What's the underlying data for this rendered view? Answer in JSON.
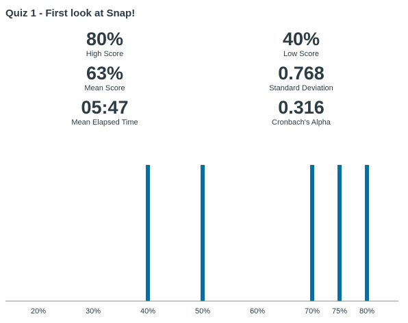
{
  "quiz": {
    "title": "Quiz 1 - First look at Snap!"
  },
  "stats": {
    "high_score": {
      "value": "80%",
      "label": "High Score"
    },
    "low_score": {
      "value": "40%",
      "label": "Low Score"
    },
    "mean_score": {
      "value": "63%",
      "label": "Mean Score"
    },
    "standard_deviation": {
      "value": "0.768",
      "label": "Standard Deviation"
    },
    "mean_elapsed_time": {
      "value": "05:47",
      "label": "Mean Elapsed Time"
    },
    "cronbachs_alpha": {
      "value": "0.316",
      "label": "Cronbach's Alpha"
    }
  },
  "colors": {
    "bar": "#0770a3",
    "axis": "#8c8c8c",
    "text": "#2d3b45"
  },
  "chart_data": {
    "type": "bar",
    "x_tick_labels": [
      "20%",
      "30%",
      "40%",
      "50%",
      "60%",
      "70%",
      "75%",
      "80%"
    ],
    "x_ticks": [
      20,
      30,
      40,
      50,
      60,
      70,
      75,
      80
    ],
    "xlim": [
      15,
      85
    ],
    "points": [
      {
        "x": 40,
        "value": 1
      },
      {
        "x": 50,
        "value": 1
      },
      {
        "x": 70,
        "value": 1
      },
      {
        "x": 75,
        "value": 1
      },
      {
        "x": 80,
        "value": 1
      }
    ],
    "ylim": [
      0,
      1
    ],
    "xlabel": "",
    "ylabel": "",
    "grid": false
  }
}
